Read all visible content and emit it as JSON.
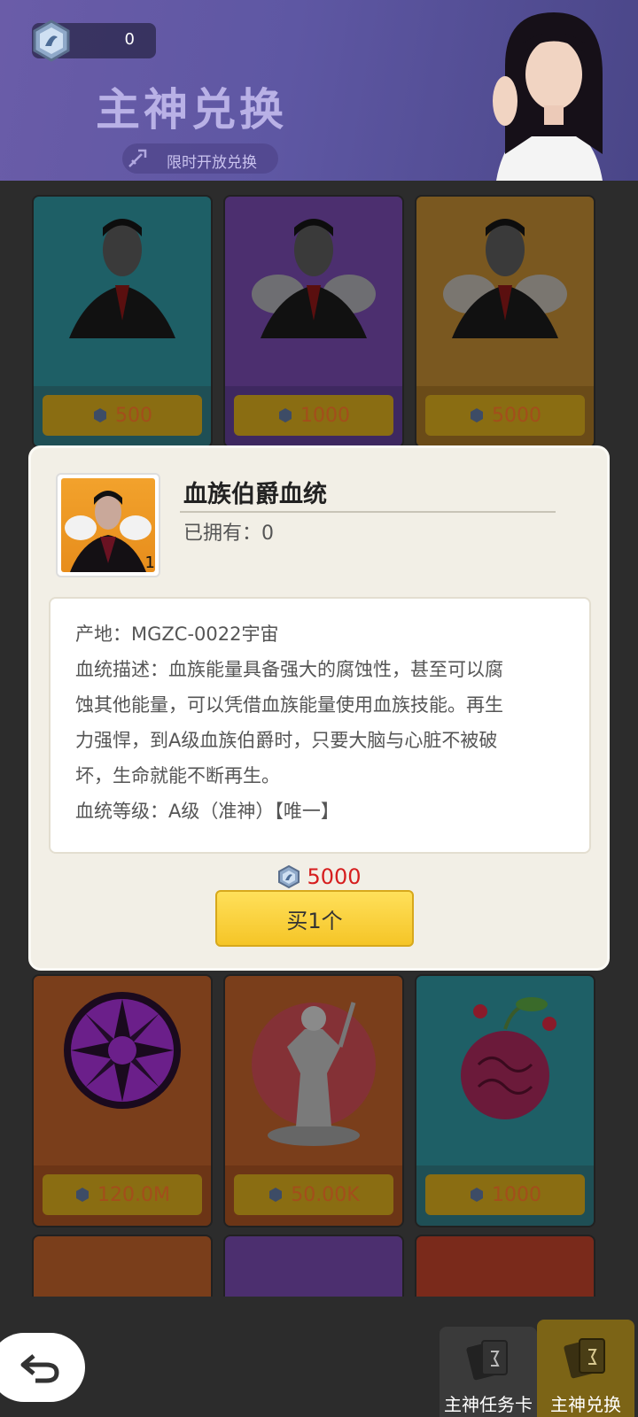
{
  "header": {
    "currency_value": "0",
    "title": "主神兑换",
    "subtitle": "限时开放兑换"
  },
  "grid": {
    "cards": [
      {
        "price": "500",
        "bg": "#1e5f66",
        "foot": "#1f4f55"
      },
      {
        "price": "1000",
        "bg": "#4c2f6f",
        "foot": "#3e2860"
      },
      {
        "price": "5000",
        "bg": "#7a5820",
        "foot": "#6a4b18"
      },
      {
        "price": "120.0M",
        "bg": "#7a3e1b",
        "foot": "#6c3516"
      },
      {
        "price": "50.00K",
        "bg": "#7a3e1b",
        "foot": "#6c3516"
      },
      {
        "price": "1000",
        "bg": "#1e5f66",
        "foot": "#1f4f55"
      }
    ]
  },
  "modal": {
    "item_name": "血族伯爵血统",
    "owned_label": "已拥有：0",
    "item_count": "1",
    "desc_lines": [
      "产地：MGZC-0022宇宙",
      "血统描述：血族能量具备强大的腐蚀性，甚至可以腐",
      "蚀其他能量，可以凭借血族能量使用血族技能。再生",
      "力强悍，到A级血族伯爵时，只要大脑与心脏不被破",
      "坏，生命就能不断再生。",
      "血统等级：A级（准神）【唯一】"
    ],
    "price": "5000",
    "buy_label": "买1个"
  },
  "bottom": {
    "tab1_label": "主神任务卡",
    "tab2_label": "主神兑换"
  },
  "colors": {
    "accent_yellow": "#f5c527",
    "price_red": "#d61e1e",
    "header_purple": "#5e57a3"
  }
}
